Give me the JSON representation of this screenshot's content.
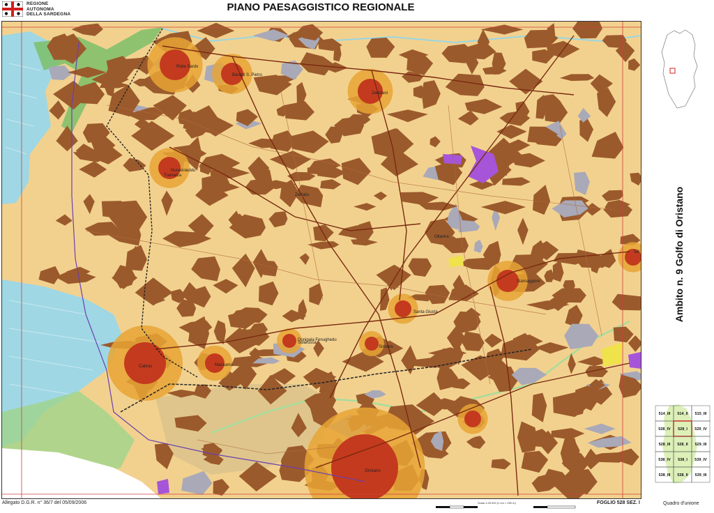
{
  "header": {
    "org_line1": "REGIONE",
    "org_line2": "AUTONOMA",
    "org_line3": "DELLA SARDEGNA",
    "title": "PIANO PAESAGGISTICO REGIONALE"
  },
  "side": {
    "ambito_title": "Ambito n. 9  Golfo di Oristano"
  },
  "map": {
    "towns": [
      "Santa Giusta",
      "Simaxis",
      "Solarussa",
      "Siamaggiore",
      "Silì",
      "Nuraxinieddu",
      "Zeddiani",
      "Baratili S. Pietro",
      "Riola Sardo",
      "Cabras",
      "Tramatza",
      "Zerfaliu",
      "Ollastra",
      "Oristano",
      "Massama",
      "Donigala Fenughedu"
    ],
    "colors": {
      "land_base": "#f2d18f",
      "agri_dark": "#9b5a2c",
      "urban": "#c43a1e",
      "urban_fringe": "#e7a435",
      "water": "#9fd7e4",
      "wetland_green": "#7cc06a",
      "protected": "#a655d8",
      "roads": "#7a2a10"
    }
  },
  "grid": {
    "cells": [
      [
        "514_III",
        "514_II",
        "515_III"
      ],
      [
        "528_IV",
        "528_I",
        "529_IV"
      ],
      [
        "528_III",
        "528_II",
        "529_III"
      ],
      [
        "538_IV",
        "538_I",
        "539_IV"
      ],
      [
        "538_III",
        "538_II",
        "539_III"
      ]
    ]
  },
  "footer": {
    "allegato": "Allegato D.G.R. n° 36/7  del 05/09/2006",
    "foglio": "FOGLIO 528  SEZ. I",
    "quadro": "Quadro d'unione",
    "scale": "Scala 1:25.000 (1 cm = 250 m)"
  }
}
